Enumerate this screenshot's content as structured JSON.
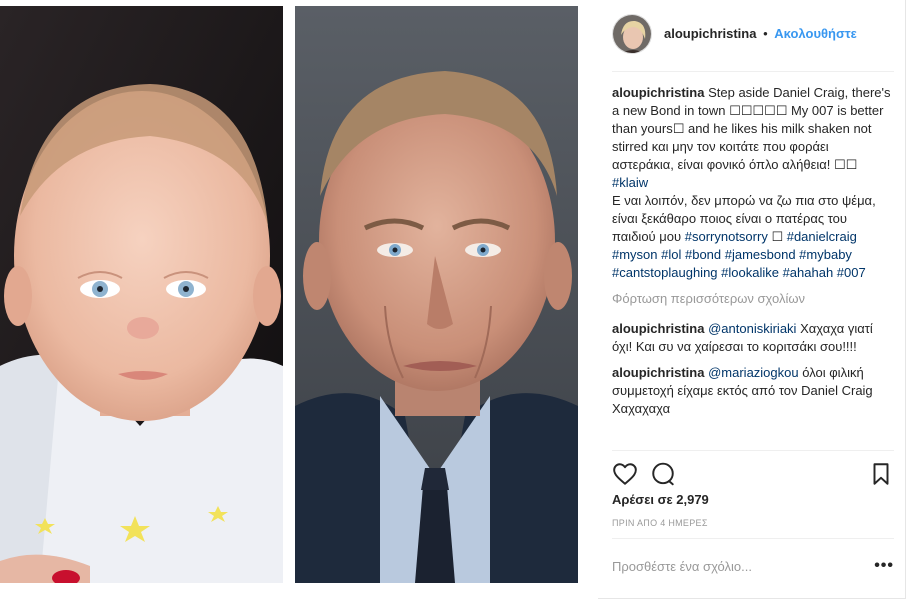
{
  "post": {
    "username": "aloupichristina",
    "separator": "•",
    "follow_label": "Ακολουθήστε",
    "caption": {
      "username": "aloupichristina",
      "text": "Step aside Daniel Craig, there's a new Bond in town ☐☐☐☐☐ My 007 is better than yours☐ and he likes his milk shaken not stirred και μην τον κοιτάτε που φοράει αστεράκια, είναι φονικό όπλο αλήθεια! ☐☐",
      "tag1": "#klaiw",
      "text2": "Ε ναι λοιπόν, δεν μπορώ να ζω πια στο ψέμα, είναι ξεκάθαρο ποιος είναι ο πατέρας του παιδιού μου",
      "tag2": "#sorrynotsorry",
      "emoji_after_tag2": "☐",
      "tags": "#danielcraig #myson #lol #bond #jamesbond #mybaby #cantstoplaughing #lookalike #ahahah #007"
    },
    "load_more": "Φόρτωση περισσότερων σχολίων",
    "comments": [
      {
        "username": "aloupichristina",
        "mention": "@antoniskiriaki",
        "text": "Χαχαχα γιατί όχι! Και συ να χαίρεσαι το κοριτσάκι σου!!!!"
      },
      {
        "username": "aloupichristina",
        "mention": "@mariaziogkou",
        "text": "όλοι φιλική συμμετοχή είχαμε εκτός από τον Daniel Craig Χαχαχαχα"
      }
    ],
    "likes": "Αρέσει σε 2,979",
    "time": "ΠΡΙΝ ΑΠΟ 4 ΗΜΕΡΕΣ",
    "add_comment_placeholder": "Προσθέστε ένα σχόλιο...",
    "more_label": "•••"
  },
  "icons": {
    "like": "heart-icon",
    "comment": "comment-icon",
    "save": "bookmark-icon"
  },
  "colors": {
    "accent": "#3897f0",
    "hashtag": "#003569",
    "muted": "#999999"
  }
}
